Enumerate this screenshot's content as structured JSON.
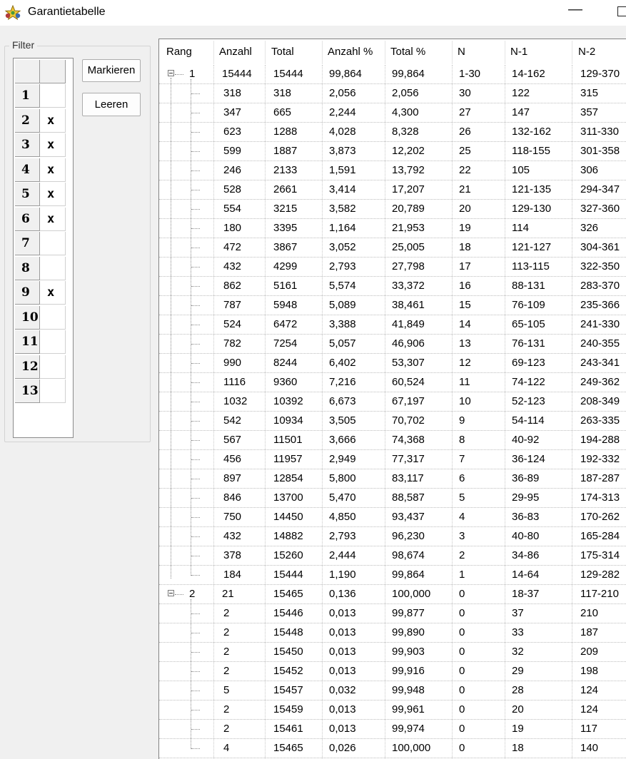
{
  "window": {
    "title": "Garantietabelle",
    "minimize_glyph": "—"
  },
  "filter": {
    "legend": "Filter",
    "rows": [
      {
        "label": "1",
        "mark": ""
      },
      {
        "label": "2",
        "mark": "x"
      },
      {
        "label": "3",
        "mark": "x"
      },
      {
        "label": "4",
        "mark": "x"
      },
      {
        "label": "5",
        "mark": "x"
      },
      {
        "label": "6",
        "mark": "x"
      },
      {
        "label": "7",
        "mark": ""
      },
      {
        "label": "8",
        "mark": ""
      },
      {
        "label": "9",
        "mark": "x"
      },
      {
        "label": "10",
        "mark": ""
      },
      {
        "label": "11",
        "mark": ""
      },
      {
        "label": "12",
        "mark": ""
      },
      {
        "label": "13",
        "mark": ""
      }
    ],
    "mark_button": "Markieren",
    "clear_button": "Leeren"
  },
  "table": {
    "columns": [
      "Rang",
      "Anzahl",
      "Total",
      "Anzahl %",
      "Total %",
      "N",
      "N-1",
      "N-2"
    ],
    "groups": [
      {
        "rang": "1",
        "summary": [
          "15444",
          "15444",
          "99,864",
          "99,864",
          "1-30",
          "14-162",
          "129-370"
        ],
        "children": [
          [
            "318",
            "318",
            "2,056",
            "2,056",
            "30",
            "122",
            "315"
          ],
          [
            "347",
            "665",
            "2,244",
            "4,300",
            "27",
            "147",
            "357"
          ],
          [
            "623",
            "1288",
            "4,028",
            "8,328",
            "26",
            "132-162",
            "311-330"
          ],
          [
            "599",
            "1887",
            "3,873",
            "12,202",
            "25",
            "118-155",
            "301-358"
          ],
          [
            "246",
            "2133",
            "1,591",
            "13,792",
            "22",
            "105",
            "306"
          ],
          [
            "528",
            "2661",
            "3,414",
            "17,207",
            "21",
            "121-135",
            "294-347"
          ],
          [
            "554",
            "3215",
            "3,582",
            "20,789",
            "20",
            "129-130",
            "327-360"
          ],
          [
            "180",
            "3395",
            "1,164",
            "21,953",
            "19",
            "114",
            "326"
          ],
          [
            "472",
            "3867",
            "3,052",
            "25,005",
            "18",
            "121-127",
            "304-361"
          ],
          [
            "432",
            "4299",
            "2,793",
            "27,798",
            "17",
            "113-115",
            "322-350"
          ],
          [
            "862",
            "5161",
            "5,574",
            "33,372",
            "16",
            "88-131",
            "283-370"
          ],
          [
            "787",
            "5948",
            "5,089",
            "38,461",
            "15",
            "76-109",
            "235-366"
          ],
          [
            "524",
            "6472",
            "3,388",
            "41,849",
            "14",
            "65-105",
            "241-330"
          ],
          [
            "782",
            "7254",
            "5,057",
            "46,906",
            "13",
            "76-131",
            "240-355"
          ],
          [
            "990",
            "8244",
            "6,402",
            "53,307",
            "12",
            "69-123",
            "243-341"
          ],
          [
            "1116",
            "9360",
            "7,216",
            "60,524",
            "11",
            "74-122",
            "249-362"
          ],
          [
            "1032",
            "10392",
            "6,673",
            "67,197",
            "10",
            "52-123",
            "208-349"
          ],
          [
            "542",
            "10934",
            "3,505",
            "70,702",
            "9",
            "54-114",
            "263-335"
          ],
          [
            "567",
            "11501",
            "3,666",
            "74,368",
            "8",
            "40-92",
            "194-288"
          ],
          [
            "456",
            "11957",
            "2,949",
            "77,317",
            "7",
            "36-124",
            "192-332"
          ],
          [
            "897",
            "12854",
            "5,800",
            "83,117",
            "6",
            "36-89",
            "187-287"
          ],
          [
            "846",
            "13700",
            "5,470",
            "88,587",
            "5",
            "29-95",
            "174-313"
          ],
          [
            "750",
            "14450",
            "4,850",
            "93,437",
            "4",
            "36-83",
            "170-262"
          ],
          [
            "432",
            "14882",
            "2,793",
            "96,230",
            "3",
            "40-80",
            "165-284"
          ],
          [
            "378",
            "15260",
            "2,444",
            "98,674",
            "2",
            "34-86",
            "175-314"
          ],
          [
            "184",
            "15444",
            "1,190",
            "99,864",
            "1",
            "14-64",
            "129-282"
          ]
        ]
      },
      {
        "rang": "2",
        "summary": [
          "21",
          "15465",
          "0,136",
          "100,000",
          "0",
          "18-37",
          "117-210"
        ],
        "children": [
          [
            "2",
            "15446",
            "0,013",
            "99,877",
            "0",
            "37",
            "210"
          ],
          [
            "2",
            "15448",
            "0,013",
            "99,890",
            "0",
            "33",
            "187"
          ],
          [
            "2",
            "15450",
            "0,013",
            "99,903",
            "0",
            "32",
            "209"
          ],
          [
            "2",
            "15452",
            "0,013",
            "99,916",
            "0",
            "29",
            "198"
          ],
          [
            "5",
            "15457",
            "0,032",
            "99,948",
            "0",
            "28",
            "124"
          ],
          [
            "2",
            "15459",
            "0,013",
            "99,961",
            "0",
            "20",
            "124"
          ],
          [
            "2",
            "15461",
            "0,013",
            "99,974",
            "0",
            "19",
            "117"
          ],
          [
            "4",
            "15465",
            "0,026",
            "100,000",
            "0",
            "18",
            "140"
          ]
        ]
      }
    ]
  }
}
